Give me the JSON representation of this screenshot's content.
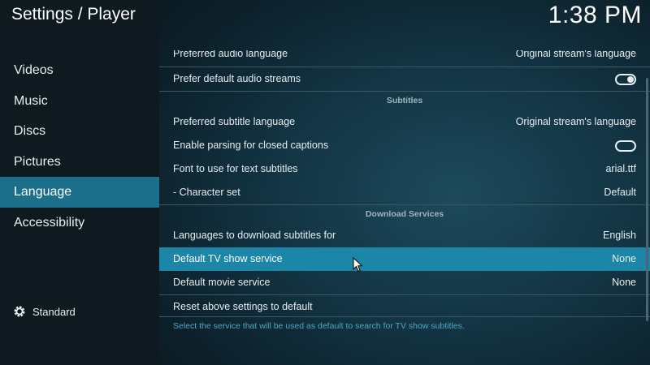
{
  "header": {
    "title": "Settings / Player",
    "clock": "1:38 PM"
  },
  "sidebar": {
    "items": [
      {
        "label": "Videos"
      },
      {
        "label": "Music"
      },
      {
        "label": "Discs"
      },
      {
        "label": "Pictures"
      },
      {
        "label": "Language"
      },
      {
        "label": "Accessibility"
      }
    ],
    "active_index": 4,
    "level_label": "Standard"
  },
  "settings": {
    "preferred_audio_language": {
      "label": "Preferred audio language",
      "value": "Original stream's language"
    },
    "prefer_default_audio_streams": {
      "label": "Prefer default audio streams",
      "toggle": "on"
    },
    "subtitles_header": "Subtitles",
    "preferred_subtitle_language": {
      "label": "Preferred subtitle language",
      "value": "Original stream's language"
    },
    "closed_captions": {
      "label": "Enable parsing for closed captions",
      "toggle": "off"
    },
    "subtitle_font": {
      "label": "Font to use for text subtitles",
      "value": "arial.ttf"
    },
    "character_set": {
      "label": "- Character set",
      "value": "Default"
    },
    "download_services_header": "Download Services",
    "download_languages": {
      "label": "Languages to download subtitles for",
      "value": "English"
    },
    "tv_show_service": {
      "label": "Default TV show service",
      "value": "None"
    },
    "movie_service": {
      "label": "Default movie service",
      "value": "None"
    },
    "reset_label": "Reset above settings to default"
  },
  "description": "Select the service that will be used as default to search for TV show subtitles.",
  "colors": {
    "accent": "#1b86a8",
    "sidebar_active": "#1b6f8a",
    "description_text": "#4fa6c8"
  }
}
